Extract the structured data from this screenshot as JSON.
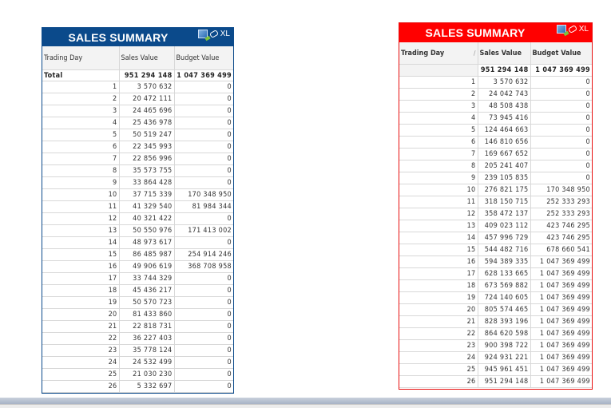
{
  "left_table": {
    "title": "SALES SUMMARY",
    "xl_label": "XL",
    "accent": "#0b4a8b",
    "headers": [
      "Trading Day",
      "Sales Value",
      "Budget Value"
    ],
    "total_label": "Total",
    "total_sales": "951 294 148",
    "total_budget": "1 047 369 499",
    "rows": [
      [
        "1",
        "3 570 632",
        "0"
      ],
      [
        "2",
        "20 472 111",
        "0"
      ],
      [
        "3",
        "24 465 696",
        "0"
      ],
      [
        "4",
        "25 436 978",
        "0"
      ],
      [
        "5",
        "50 519 247",
        "0"
      ],
      [
        "6",
        "22 345 993",
        "0"
      ],
      [
        "7",
        "22 856 996",
        "0"
      ],
      [
        "8",
        "35 573 755",
        "0"
      ],
      [
        "9",
        "33 864 428",
        "0"
      ],
      [
        "10",
        "37 715 339",
        "170 348 950"
      ],
      [
        "11",
        "41 329 540",
        "81 984 344"
      ],
      [
        "12",
        "40 321 422",
        "0"
      ],
      [
        "13",
        "50 550 976",
        "171 413 002"
      ],
      [
        "14",
        "48 973 617",
        "0"
      ],
      [
        "15",
        "86 485 987",
        "254 914 246"
      ],
      [
        "16",
        "49 906 619",
        "368 708 958"
      ],
      [
        "17",
        "33 744 329",
        "0"
      ],
      [
        "18",
        "45 436 217",
        "0"
      ],
      [
        "19",
        "50 570 723",
        "0"
      ],
      [
        "20",
        "81 433 860",
        "0"
      ],
      [
        "21",
        "22 818 731",
        "0"
      ],
      [
        "22",
        "36 227 403",
        "0"
      ],
      [
        "23",
        "35 778 124",
        "0"
      ],
      [
        "24",
        "24 532 499",
        "0"
      ],
      [
        "25",
        "21 030 230",
        "0"
      ],
      [
        "26",
        "5 332 697",
        "0"
      ]
    ]
  },
  "right_table": {
    "title": "SALES SUMMARY",
    "xl_label": "XL",
    "accent": "#ff0000",
    "headers": [
      "Trading Day",
      "Sales Value",
      "Budget Value"
    ],
    "total_sales": "951 294 148",
    "total_budget": "1 047 369 499",
    "rows": [
      [
        "1",
        "3 570 632",
        "0"
      ],
      [
        "2",
        "24 042 743",
        "0"
      ],
      [
        "3",
        "48 508 438",
        "0"
      ],
      [
        "4",
        "73 945 416",
        "0"
      ],
      [
        "5",
        "124 464 663",
        "0"
      ],
      [
        "6",
        "146 810 656",
        "0"
      ],
      [
        "7",
        "169 667 652",
        "0"
      ],
      [
        "8",
        "205 241 407",
        "0"
      ],
      [
        "9",
        "239 105 835",
        "0"
      ],
      [
        "10",
        "276 821 175",
        "170 348 950"
      ],
      [
        "11",
        "318 150 715",
        "252 333 293"
      ],
      [
        "12",
        "358 472 137",
        "252 333 293"
      ],
      [
        "13",
        "409 023 112",
        "423 746 295"
      ],
      [
        "14",
        "457 996 729",
        "423 746 295"
      ],
      [
        "15",
        "544 482 716",
        "678 660 541"
      ],
      [
        "16",
        "594 389 335",
        "1 047 369 499"
      ],
      [
        "17",
        "628 133 665",
        "1 047 369 499"
      ],
      [
        "18",
        "673 569 882",
        "1 047 369 499"
      ],
      [
        "19",
        "724 140 605",
        "1 047 369 499"
      ],
      [
        "20",
        "805 574 465",
        "1 047 369 499"
      ],
      [
        "21",
        "828 393 196",
        "1 047 369 499"
      ],
      [
        "22",
        "864 620 598",
        "1 047 369 499"
      ],
      [
        "23",
        "900 398 722",
        "1 047 369 499"
      ],
      [
        "24",
        "924 931 221",
        "1 047 369 499"
      ],
      [
        "25",
        "945 961 451",
        "1 047 369 499"
      ],
      [
        "26",
        "951 294 148",
        "1 047 369 499"
      ]
    ]
  }
}
